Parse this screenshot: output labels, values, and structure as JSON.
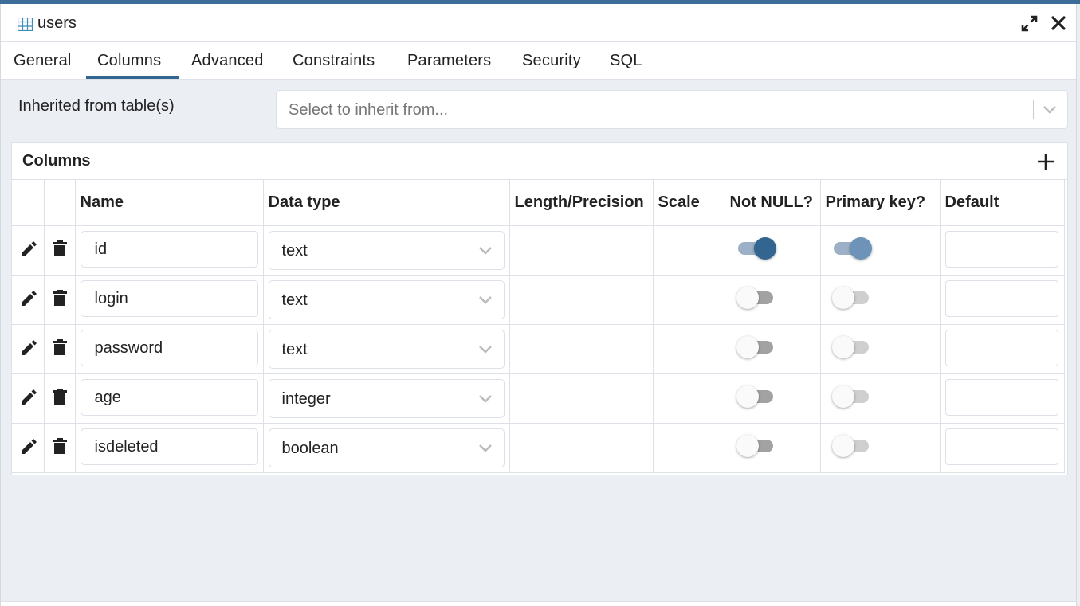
{
  "window": {
    "title": "users"
  },
  "tabs": [
    "General",
    "Columns",
    "Advanced",
    "Constraints",
    "Parameters",
    "Security",
    "SQL"
  ],
  "active_tab": "Columns",
  "inherit": {
    "label": "Inherited from table(s)",
    "placeholder": "Select to inherit from..."
  },
  "columns_grid": {
    "title": "Columns",
    "headers": [
      "Name",
      "Data type",
      "Length/Precision",
      "Scale",
      "Not NULL?",
      "Primary key?",
      "Default"
    ],
    "rows": [
      {
        "name": "id",
        "type": "text",
        "not_null": true,
        "primary_key": true,
        "default": ""
      },
      {
        "name": "login",
        "type": "text",
        "not_null": false,
        "primary_key": false,
        "default": ""
      },
      {
        "name": "password",
        "type": "text",
        "not_null": false,
        "primary_key": false,
        "default": ""
      },
      {
        "name": "age",
        "type": "integer",
        "not_null": false,
        "primary_key": false,
        "default": ""
      },
      {
        "name": "isdeleted",
        "type": "boolean",
        "not_null": false,
        "primary_key": false,
        "default": ""
      }
    ]
  },
  "icons": {
    "table": "table-icon",
    "expand": "expand-icon",
    "close": "close-icon",
    "add": "plus-icon",
    "edit": "pencil-icon",
    "delete": "trash-icon",
    "dropdown": "chevron-down-icon"
  },
  "colors": {
    "accent": "#326690",
    "topbar": "#3c6d99"
  }
}
